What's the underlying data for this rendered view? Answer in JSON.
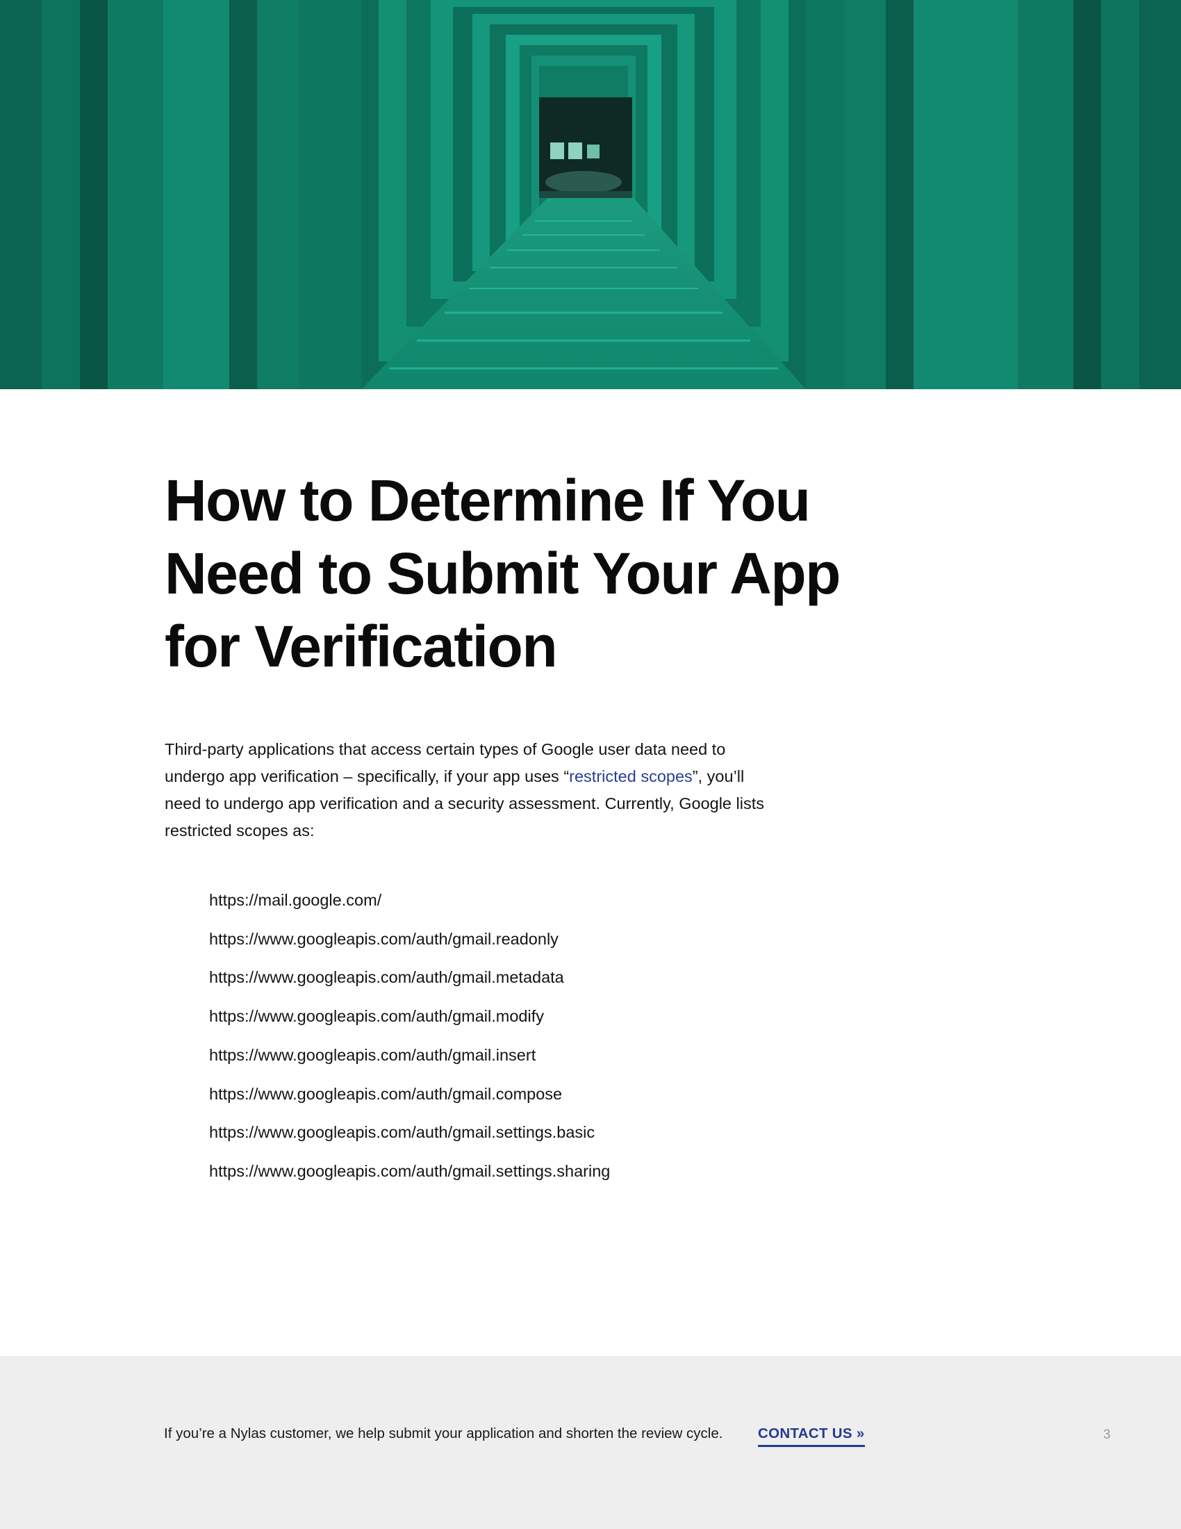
{
  "hero": {
    "colors": {
      "base": "#0d7a63",
      "dark": "#0a5a48",
      "light": "#1fa889",
      "end": "#0f2a24"
    }
  },
  "title_lines": [
    "How to Determine If You",
    "Need to Submit Your App",
    "for Verification"
  ],
  "intro": {
    "before_link": "Third-party applications that access certain types of Google user data need to undergo app verification – specifically, if your app uses “",
    "link_text": "restricted scopes",
    "after_link": "”, you’ll need to undergo app verification and a security assessment. Currently, Google lists restricted scopes as:"
  },
  "scopes": [
    "https://mail.google.com/",
    "https://www.googleapis.com/auth/gmail.readonly",
    "https://www.googleapis.com/auth/gmail.metadata",
    "https://www.googleapis.com/auth/gmail.modify",
    "https://www.googleapis.com/auth/gmail.insert",
    "https://www.googleapis.com/auth/gmail.compose",
    "https://www.googleapis.com/auth/gmail.settings.basic",
    "https://www.googleapis.com/auth/gmail.settings.sharing"
  ],
  "footer": {
    "text": "If you’re a Nylas customer, we help submit your application and shorten the review cycle.",
    "cta_label": "CONTACT US »",
    "page_number": "3"
  },
  "colors": {
    "link": "#2a3f93",
    "cta": "#233a8f",
    "footer_bg": "#eeeeee"
  }
}
